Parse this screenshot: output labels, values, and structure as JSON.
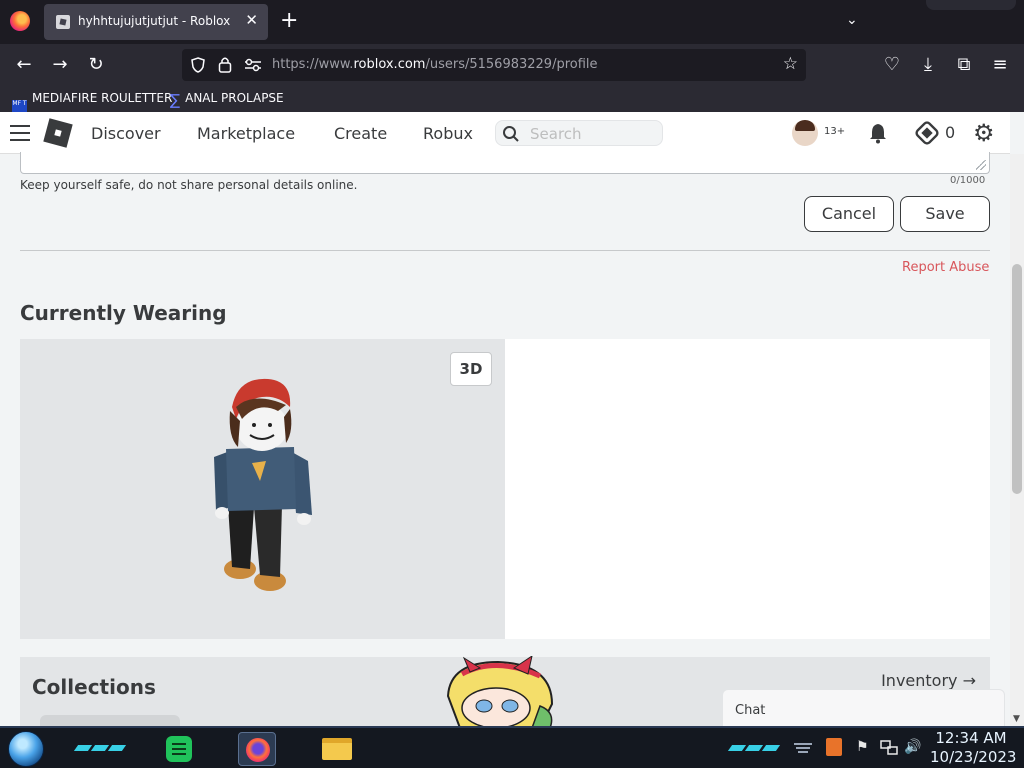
{
  "browser": {
    "tab_title": "hyhhtujujutjutjut - Roblox",
    "tab_close": "✕",
    "new_tab": "+",
    "tab_list": "⌄",
    "url_prefix": "https://www.",
    "url_domain": "roblox.com",
    "url_path": "/users/5156983229/profile",
    "bookmarks": [
      {
        "label": "MEDIAFIRE ROULETTER",
        "icon": "mediafire-icon",
        "icon_text": "MF T"
      },
      {
        "label": "ANAL PROLAPSE",
        "icon": "sigma-icon",
        "icon_text": "∑"
      }
    ],
    "nav_icons": {
      "back": "←",
      "forward": "→",
      "reload": "↻",
      "star": "☆",
      "pocket": "♡",
      "download": "⤓",
      "extensions": "⧉",
      "menu": "≡"
    }
  },
  "header": {
    "nav": [
      "Discover",
      "Marketplace",
      "Create",
      "Robux"
    ],
    "search_placeholder": "Search",
    "age_badge": "13+",
    "robux_count": "0",
    "gear": "⚙"
  },
  "about": {
    "safety_hint": "Keep yourself safe, do not share personal details online.",
    "char_counter": "0/1000",
    "cancel_label": "Cancel",
    "save_label": "Save",
    "report_label": "Report Abuse"
  },
  "wearing": {
    "title": "Currently Wearing",
    "toggle_3d": "3D"
  },
  "collections": {
    "title": "Collections",
    "inventory_label": "Inventory →"
  },
  "chat": {
    "label": "Chat"
  },
  "taskbar": {
    "time": "12:34 AM",
    "date": "10/23/2023",
    "tray": {
      "flag": "⚑",
      "speaker": "🔊"
    }
  },
  "colors": {
    "accent_report": "#d8565b",
    "page_bg": "#f2f4f5",
    "text": "#393b3d"
  }
}
